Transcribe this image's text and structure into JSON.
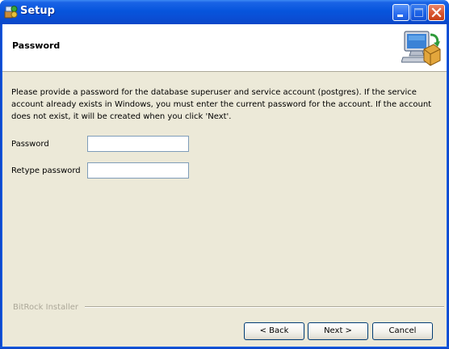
{
  "window": {
    "title": "Setup",
    "title_icon": "setup-app-icon",
    "controls": [
      "minimize-icon",
      "maximize-icon",
      "close-icon"
    ]
  },
  "header": {
    "title": "Password",
    "icon": "computer-package-icon"
  },
  "description": "Please provide a password for the database superuser and service account (postgres). If the service account already exists in Windows, you must enter the current password for the account. If the account does not exist, it will be created when you click 'Next'.",
  "form": {
    "password_label": "Password",
    "password_value": "",
    "retype_label": "Retype password",
    "retype_value": ""
  },
  "footer": {
    "brand": "BitRock Installer",
    "back_label": "< Back",
    "next_label": "Next >",
    "cancel_label": "Cancel"
  },
  "colors": {
    "titlebar": "#0655dc",
    "dialog_background": "#ece9d8",
    "header_background": "#ffffff",
    "button_border": "#003c74",
    "close_button": "#d8552e"
  }
}
